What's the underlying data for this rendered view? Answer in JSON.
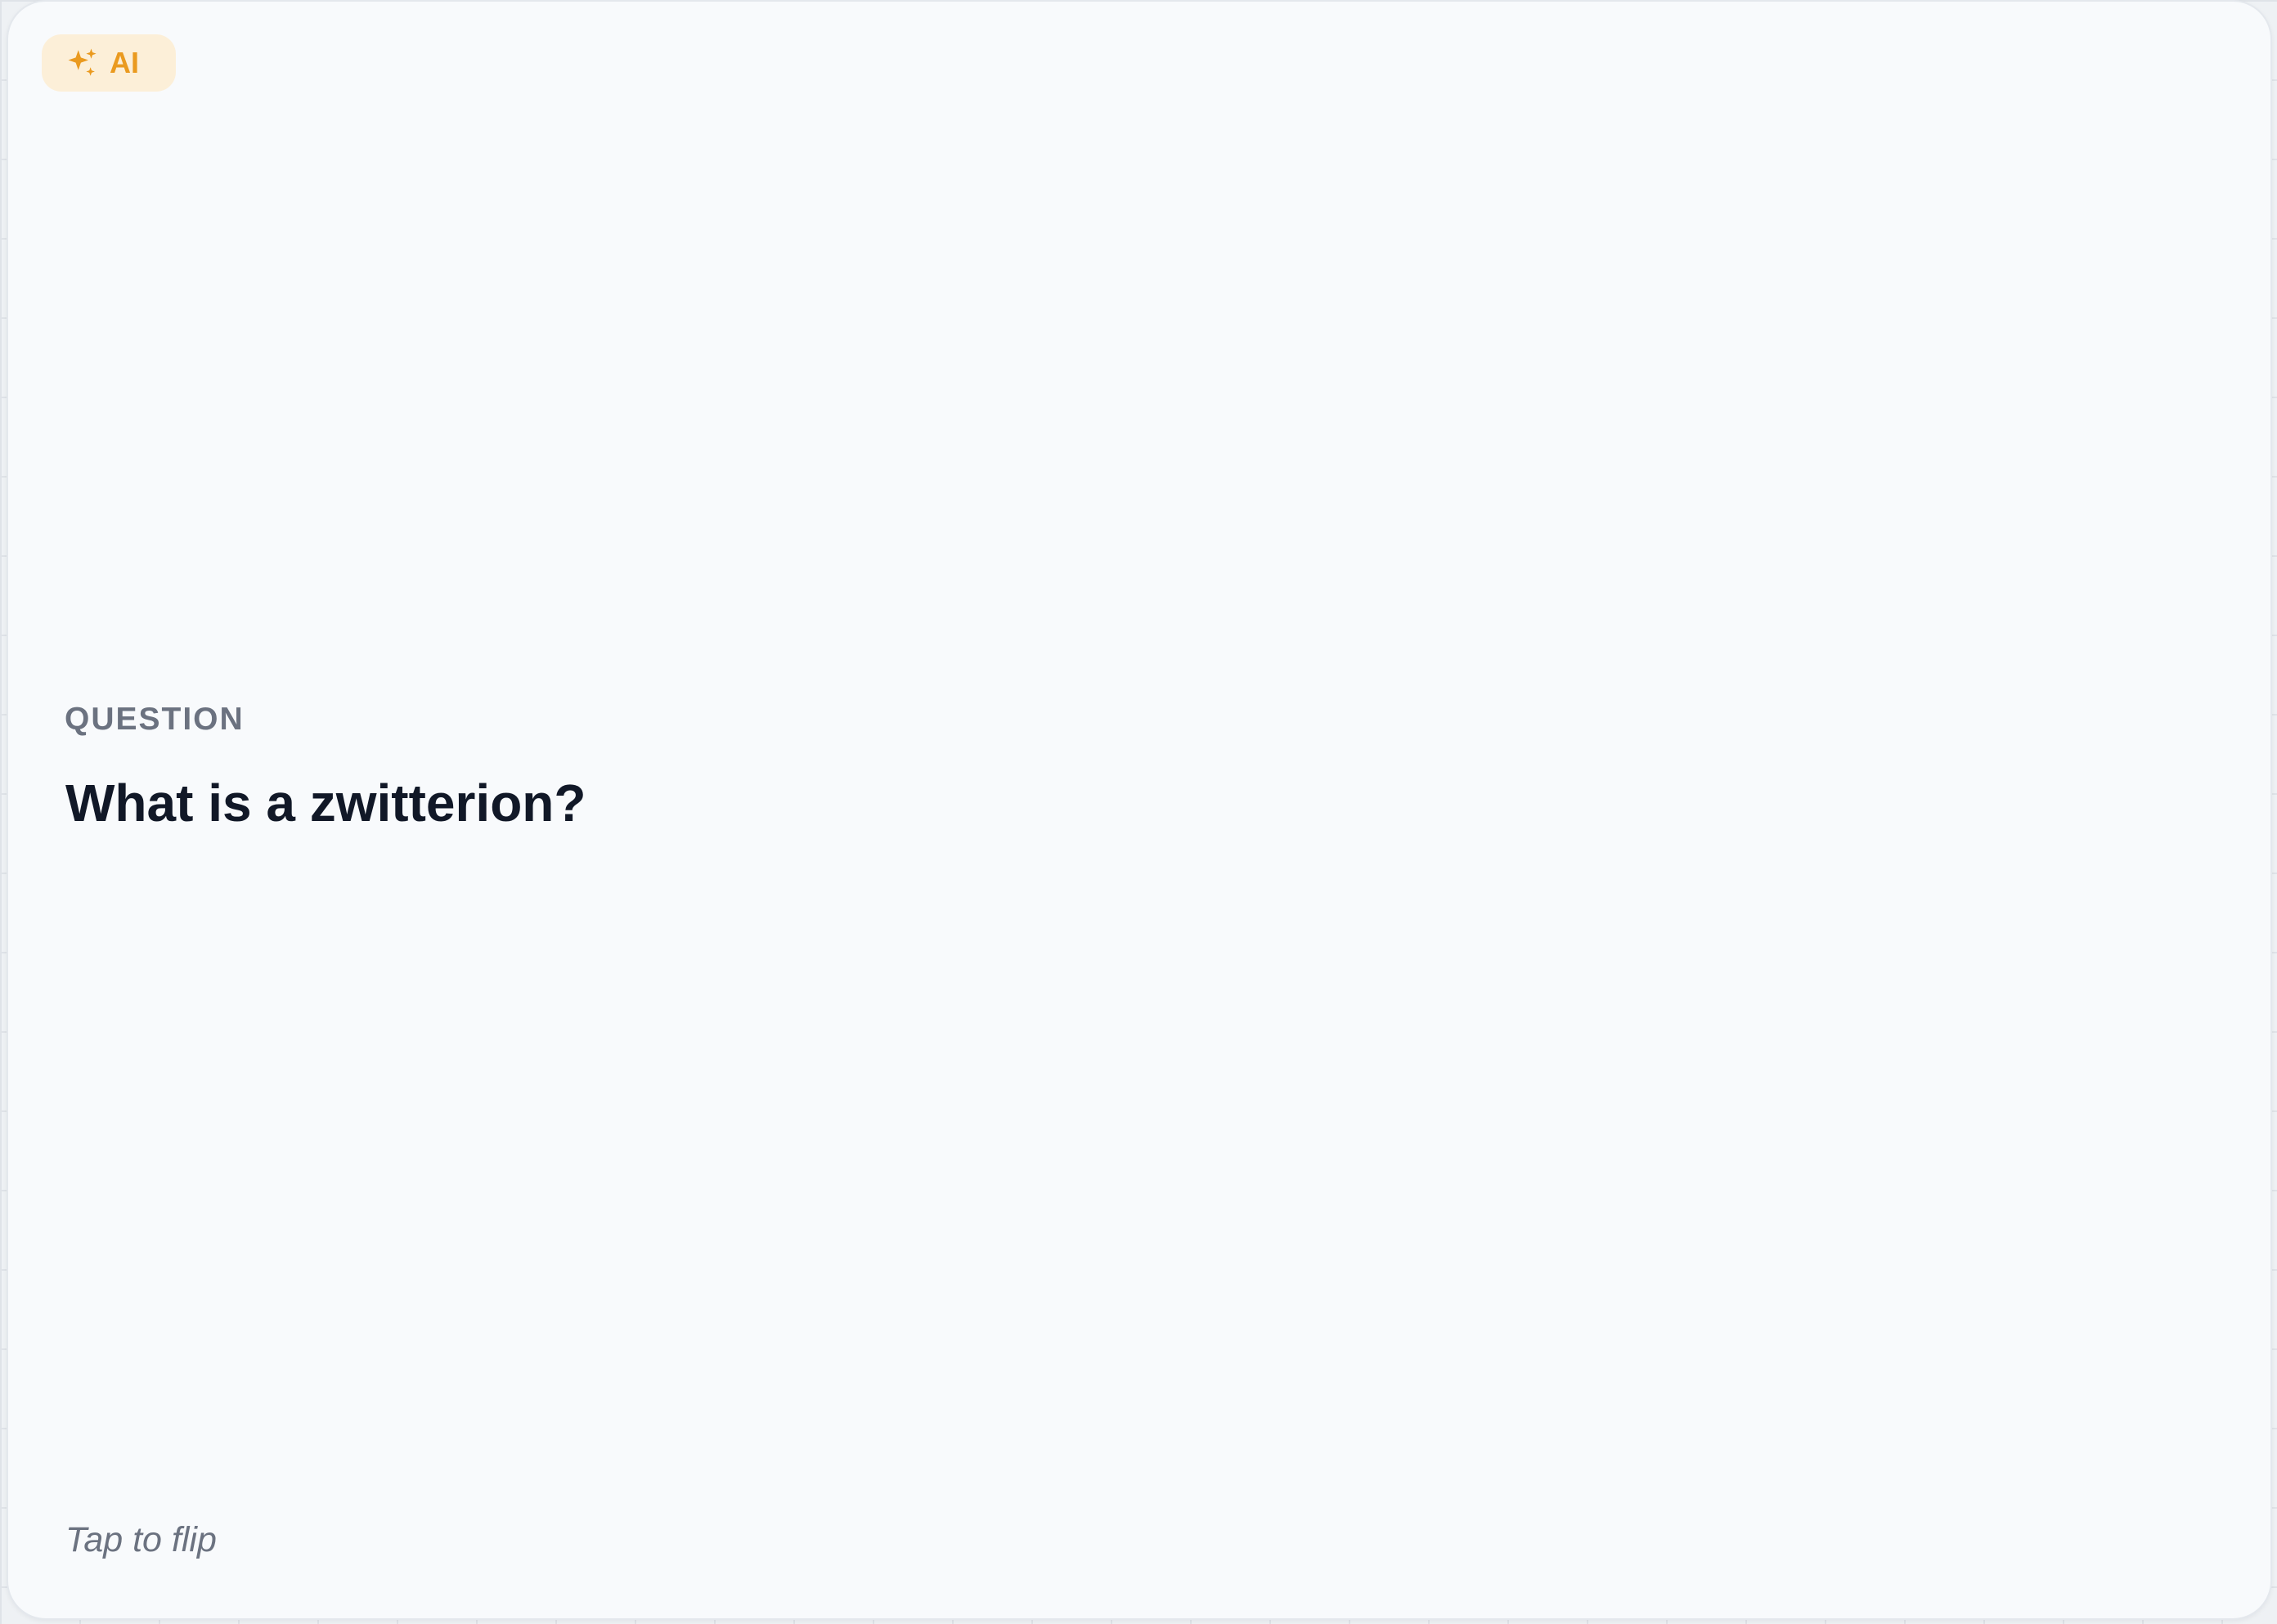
{
  "card": {
    "badge": {
      "icon": "sparkles-icon",
      "label": "AI"
    },
    "section_label": "QUESTION",
    "question": "What is a zwitterion?",
    "hint": "Tap to flip"
  },
  "colors": {
    "accent": "#ea9a1f",
    "badge_bg": "#fcefd8",
    "card_bg": "#f8fafc",
    "text_primary": "#111827",
    "text_secondary": "#6b7280"
  }
}
